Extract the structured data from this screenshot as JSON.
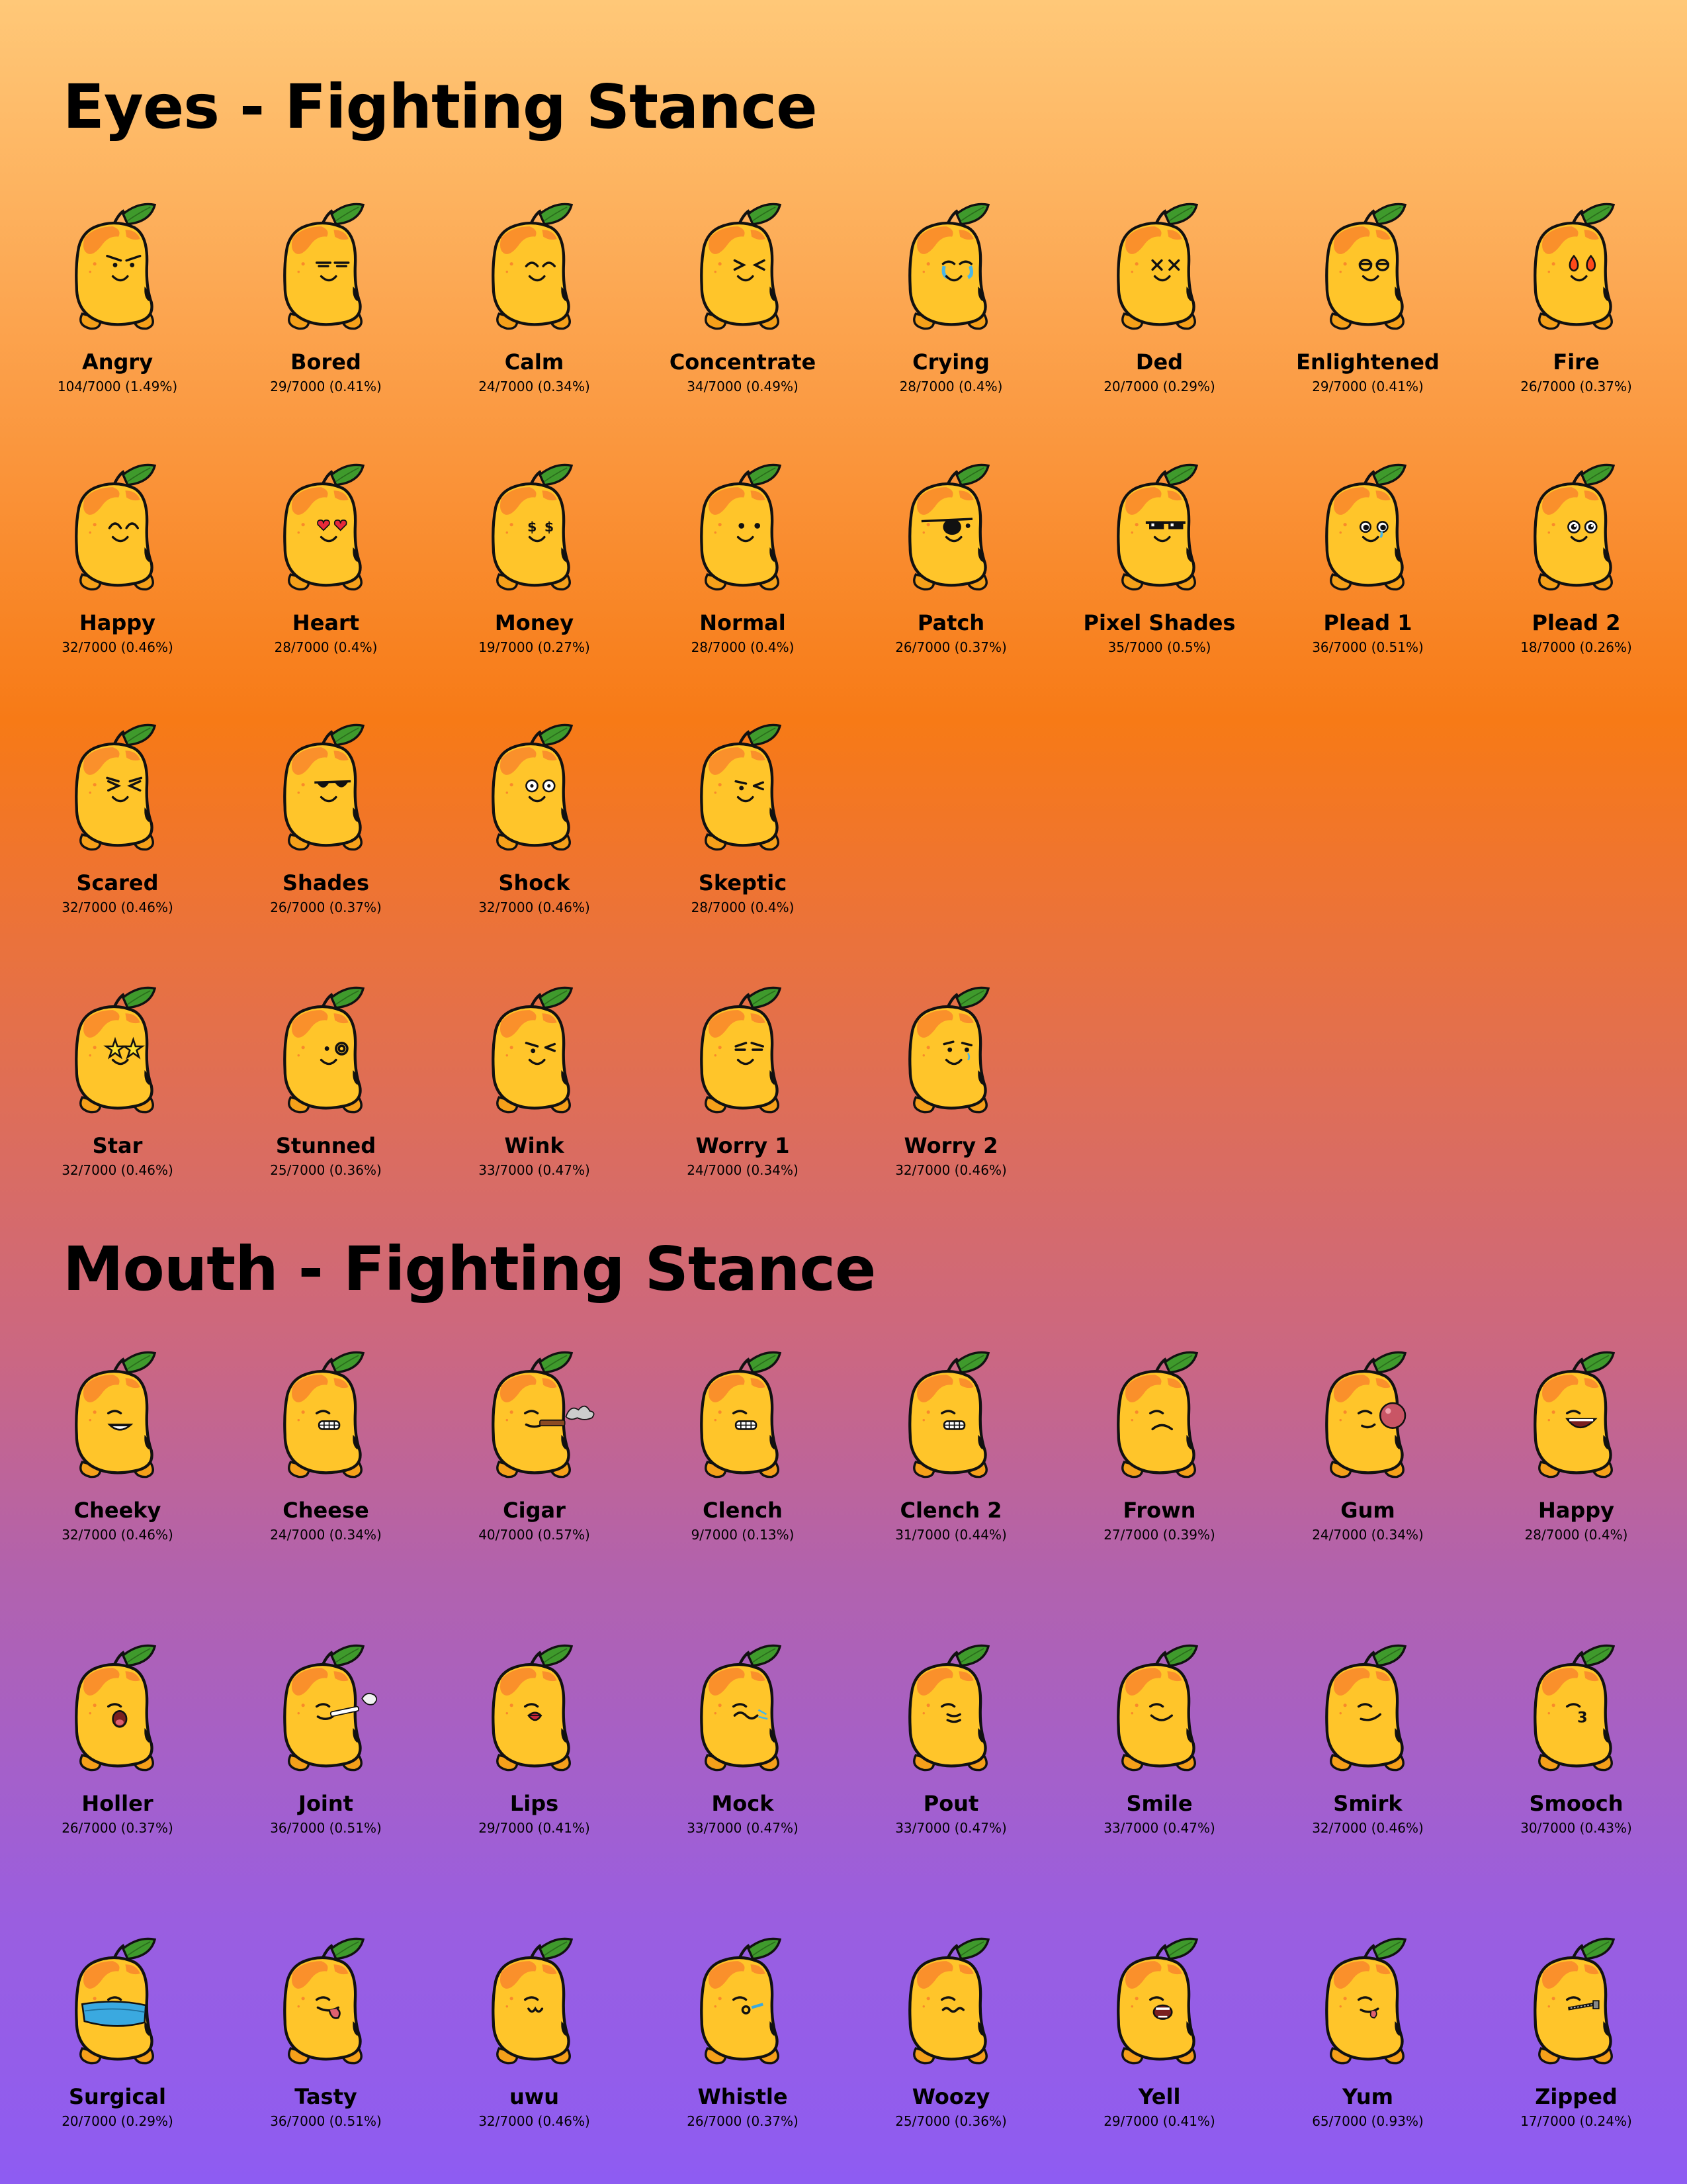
{
  "sections": {
    "eyes": {
      "title": "Eyes - Fighting Stance",
      "rows": [
        [
          {
            "name": "Angry",
            "count": "104/7000 (1.49%)",
            "expr": "angry"
          },
          {
            "name": "Bored",
            "count": "29/7000 (0.41%)",
            "expr": "bored"
          },
          {
            "name": "Calm",
            "count": "24/7000 (0.34%)",
            "expr": "calm"
          },
          {
            "name": "Concentrate",
            "count": "34/7000 (0.49%)",
            "expr": "concentrate"
          },
          {
            "name": "Crying",
            "count": "28/7000 (0.4%)",
            "expr": "crying"
          },
          {
            "name": "Ded",
            "count": "20/7000 (0.29%)",
            "expr": "ded"
          },
          {
            "name": "Enlightened",
            "count": "29/7000 (0.41%)",
            "expr": "enlightened"
          },
          {
            "name": "Fire",
            "count": "26/7000 (0.37%)",
            "expr": "fire"
          }
        ],
        [
          {
            "name": "Happy",
            "count": "32/7000 (0.46%)",
            "expr": "happy"
          },
          {
            "name": "Heart",
            "count": "28/7000 (0.4%)",
            "expr": "heart"
          },
          {
            "name": "Money",
            "count": "19/7000 (0.27%)",
            "expr": "money"
          },
          {
            "name": "Normal",
            "count": "28/7000 (0.4%)",
            "expr": "normal"
          },
          {
            "name": "Patch",
            "count": "26/7000 (0.37%)",
            "expr": "patch"
          },
          {
            "name": "Pixel Shades",
            "count": "35/7000 (0.5%)",
            "expr": "pixelshades"
          },
          {
            "name": "Plead 1",
            "count": "36/7000 (0.51%)",
            "expr": "plead"
          },
          {
            "name": "Plead 2",
            "count": "18/7000 (0.26%)",
            "expr": "plead2"
          }
        ],
        [
          {
            "name": "Scared",
            "count": "32/7000 (0.46%)",
            "expr": "scared"
          },
          {
            "name": "Shades",
            "count": "26/7000 (0.37%)",
            "expr": "shades"
          },
          {
            "name": "Shock",
            "count": "32/7000 (0.46%)",
            "expr": "shock"
          },
          {
            "name": "Skeptic",
            "count": "28/7000 (0.4%)",
            "expr": "skeptic"
          }
        ],
        [
          {
            "name": "Star",
            "count": "32/7000 (0.46%)",
            "expr": "star"
          },
          {
            "name": "Stunned",
            "count": "25/7000 (0.36%)",
            "expr": "stunned"
          },
          {
            "name": "Wink",
            "count": "33/7000 (0.47%)",
            "expr": "wink"
          },
          {
            "name": "Worry 1",
            "count": "24/7000 (0.34%)",
            "expr": "worry"
          },
          {
            "name": "Worry 2",
            "count": "32/7000 (0.46%)",
            "expr": "worry2"
          }
        ]
      ]
    },
    "mouth": {
      "title": "Mouth - Fighting Stance",
      "rows": [
        [
          {
            "name": "Cheeky",
            "count": "32/7000 (0.46%)",
            "expr": "m-cheeky"
          },
          {
            "name": "Cheese",
            "count": "24/7000 (0.34%)",
            "expr": "m-teeth"
          },
          {
            "name": "Cigar",
            "count": "40/7000 (0.57%)",
            "expr": "m-cigar"
          },
          {
            "name": "Clench",
            "count": "9/7000 (0.13%)",
            "expr": "m-teeth"
          },
          {
            "name": "Clench 2",
            "count": "31/7000 (0.44%)",
            "expr": "m-teeth"
          },
          {
            "name": "Frown",
            "count": "27/7000 (0.39%)",
            "expr": "m-frown"
          },
          {
            "name": "Gum",
            "count": "24/7000 (0.34%)",
            "expr": "m-gum"
          },
          {
            "name": "Happy",
            "count": "28/7000 (0.4%)",
            "expr": "m-open"
          }
        ],
        [
          {
            "name": "Holler",
            "count": "26/7000 (0.37%)",
            "expr": "m-holler"
          },
          {
            "name": "Joint",
            "count": "36/7000 (0.51%)",
            "expr": "m-joint"
          },
          {
            "name": "Lips",
            "count": "29/7000 (0.41%)",
            "expr": "m-lips"
          },
          {
            "name": "Mock",
            "count": "33/7000 (0.47%)",
            "expr": "m-mock"
          },
          {
            "name": "Pout",
            "count": "33/7000 (0.47%)",
            "expr": "m-pout"
          },
          {
            "name": "Smile",
            "count": "33/7000 (0.47%)",
            "expr": "m-smile"
          },
          {
            "name": "Smirk",
            "count": "32/7000 (0.46%)",
            "expr": "m-smirk"
          },
          {
            "name": "Smooch",
            "count": "30/7000 (0.43%)",
            "expr": "m-smooch"
          }
        ],
        [
          {
            "name": "Surgical",
            "count": "20/7000 (0.29%)",
            "expr": "m-mask"
          },
          {
            "name": "Tasty",
            "count": "36/7000 (0.51%)",
            "expr": "m-tongue"
          },
          {
            "name": "uwu",
            "count": "32/7000 (0.46%)",
            "expr": "m-uwu"
          },
          {
            "name": "Whistle",
            "count": "26/7000 (0.37%)",
            "expr": "m-whistle"
          },
          {
            "name": "Woozy",
            "count": "25/7000 (0.36%)",
            "expr": "m-woozy"
          },
          {
            "name": "Yell",
            "count": "29/7000 (0.41%)",
            "expr": "m-yell"
          },
          {
            "name": "Yum",
            "count": "65/7000 (0.93%)",
            "expr": "m-yum"
          },
          {
            "name": "Zipped",
            "count": "17/7000 (0.24%)",
            "expr": "m-zip"
          }
        ]
      ]
    }
  }
}
